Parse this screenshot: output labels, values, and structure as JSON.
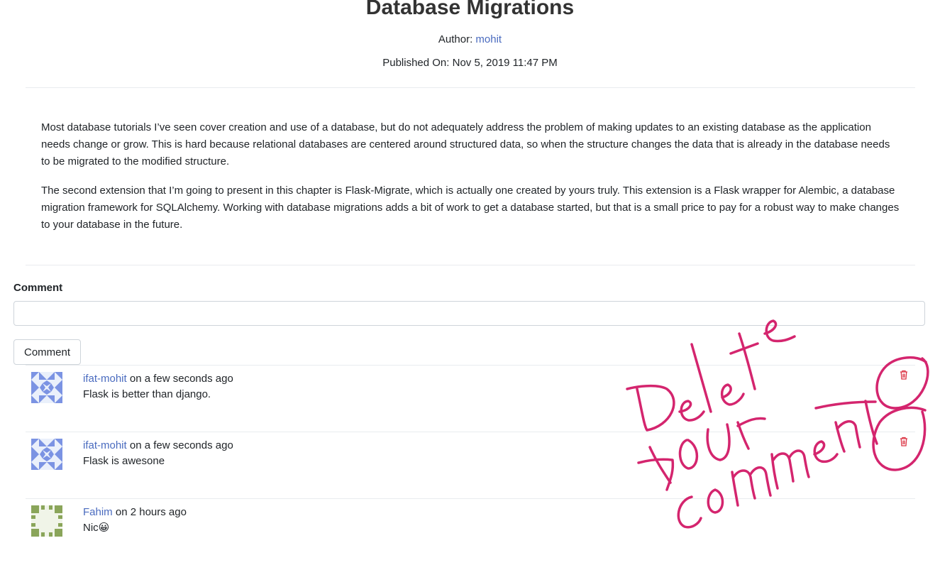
{
  "post": {
    "title": "Database Migrations",
    "author_label": "Author:",
    "author": "mohit",
    "published_label": "Published On:",
    "published": "Nov 5, 2019 11:47 PM",
    "paragraphs": [
      "Most database tutorials I’ve seen cover creation and use of a database, but do not adequately address the problem of making updates to an existing database as the application needs change or grow. This is hard because relational databases are centered around structured data, so when the structure changes the data that is already in the database needs to be migrated to the modified structure.",
      "The second extension that I’m going to present in this chapter is Flask-Migrate, which is actually one created by yours truly. This extension is a Flask wrapper for Alembic, a database migration framework for SQLAlchemy. Working with database migrations adds a bit of work to get a database started, but that is a small price to pay for a robust way to make changes to your database in the future."
    ]
  },
  "comment_form": {
    "label": "Comment",
    "value": "",
    "placeholder": "",
    "button": "Comment"
  },
  "comments": [
    {
      "user": "ifat-mohit",
      "time": "on a few seconds ago",
      "text": "Flask is better than django.",
      "deletable": true
    },
    {
      "user": "ifat-mohit",
      "time": "on a few seconds ago",
      "text": "Flask is awesone",
      "deletable": true
    },
    {
      "user": "Fahim",
      "time": "on 2 hours ago",
      "text": "Nic😀",
      "deletable": false
    }
  ],
  "annotation": {
    "text": "Delete your comment",
    "color": "#d4256e"
  },
  "colors": {
    "link": "#4a6bbf",
    "trash": "#dc3545",
    "avatar_blue": "#7b93e3",
    "avatar_green": "#8aa55a"
  }
}
